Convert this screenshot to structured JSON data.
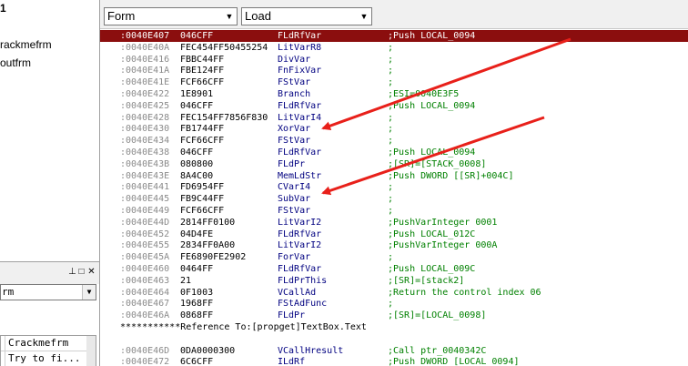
{
  "left_panel": {
    "tree_items": [
      "1",
      "rackmefrm",
      "outfrm"
    ],
    "toolbar_buttons": [
      "⊥",
      "□",
      "✕"
    ],
    "object_combo_value": "rm",
    "props": [
      {
        "key": "",
        "value": "Crackmefrm"
      },
      {
        "key": "",
        "value": "Try to fi..."
      }
    ]
  },
  "toolbar": {
    "form_combo_value": "Form",
    "event_combo_value": "Load"
  },
  "code_lines": [
    {
      "addr": ":0040E407",
      "bytes": "046CFF",
      "op": "FLdRfVar",
      "cmt": ";Push LOCAL_0094",
      "selected": true
    },
    {
      "addr": ":0040E40A",
      "bytes": "FEC454FF50455254",
      "op": "LitVarR8",
      "cmt": ";"
    },
    {
      "addr": ":0040E416",
      "bytes": "FBBC44FF",
      "op": "DivVar",
      "cmt": ";"
    },
    {
      "addr": ":0040E41A",
      "bytes": "FBE124FF",
      "op": "FnFixVar",
      "cmt": ";"
    },
    {
      "addr": ":0040E41E",
      "bytes": "FCF66CFF",
      "op": "FStVar",
      "cmt": ";"
    },
    {
      "addr": ":0040E422",
      "bytes": "1E8901",
      "op": "Branch",
      "cmt": ";ESI=0040E3F5"
    },
    {
      "addr": ":0040E425",
      "bytes": "046CFF",
      "op": "FLdRfVar",
      "cmt": ";Push LOCAL_0094"
    },
    {
      "addr": ":0040E428",
      "bytes": "FEC154FF7856F830",
      "op": "LitVarI4",
      "cmt": ";"
    },
    {
      "addr": ":0040E430",
      "bytes": "FB1744FF",
      "op": "XorVar",
      "cmt": ";"
    },
    {
      "addr": ":0040E434",
      "bytes": "FCF66CFF",
      "op": "FStVar",
      "cmt": ";"
    },
    {
      "addr": ":0040E438",
      "bytes": "046CFF",
      "op": "FLdRfVar",
      "cmt": ";Push LOCAL_0094"
    },
    {
      "addr": ":0040E43B",
      "bytes": "080800",
      "op": "FLdPr",
      "cmt": ";[SR]=[STACK_0008]"
    },
    {
      "addr": ":0040E43E",
      "bytes": "8A4C00",
      "op": "MemLdStr",
      "cmt": ";Push DWORD [[SR]+004C]"
    },
    {
      "addr": ":0040E441",
      "bytes": "FD6954FF",
      "op": "CVarI4",
      "cmt": ";"
    },
    {
      "addr": ":0040E445",
      "bytes": "FB9C44FF",
      "op": "SubVar",
      "cmt": ";"
    },
    {
      "addr": ":0040E449",
      "bytes": "FCF66CFF",
      "op": "FStVar",
      "cmt": ";"
    },
    {
      "addr": ":0040E44D",
      "bytes": "2814FF0100",
      "op": "LitVarI2",
      "cmt": ";PushVarInteger 0001"
    },
    {
      "addr": ":0040E452",
      "bytes": "04D4FE",
      "op": "FLdRfVar",
      "cmt": ";Push LOCAL_012C"
    },
    {
      "addr": ":0040E455",
      "bytes": "2834FF0A00",
      "op": "LitVarI2",
      "cmt": ";PushVarInteger 000A"
    },
    {
      "addr": ":0040E45A",
      "bytes": "FE6890FE2902",
      "op": "ForVar",
      "cmt": ";"
    },
    {
      "addr": ":0040E460",
      "bytes": "0464FF",
      "op": "FLdRfVar",
      "cmt": ";Push LOCAL_009C"
    },
    {
      "addr": ":0040E463",
      "bytes": "21",
      "op": "FLdPrThis",
      "cmt": ";[SR]=[stack2]"
    },
    {
      "addr": ":0040E464",
      "bytes": "0F1003",
      "op": "VCallAd",
      "cmt": ";Return the control index 06"
    },
    {
      "addr": ":0040E467",
      "bytes": "1968FF",
      "op": "FStAdFunc",
      "cmt": ";"
    },
    {
      "addr": ":0040E46A",
      "bytes": "0868FF",
      "op": "FLdPr",
      "cmt": ";[SR]=[LOCAL_0098]"
    },
    {
      "reference": "***********Reference To:[propget]TextBox.Text"
    },
    {
      "blank": true
    },
    {
      "addr": ":0040E46D",
      "bytes": "0DA0000300",
      "op": "VCallHresult",
      "cmt": ";Call ptr_0040342C"
    },
    {
      "addr": ":0040E472",
      "bytes": "6C6CFF",
      "op": "ILdRf",
      "cmt": ";Push DWORD [LOCAL_0094]"
    }
  ],
  "annotation_color": "#e8201a",
  "selection_color": "#8b0e0e"
}
